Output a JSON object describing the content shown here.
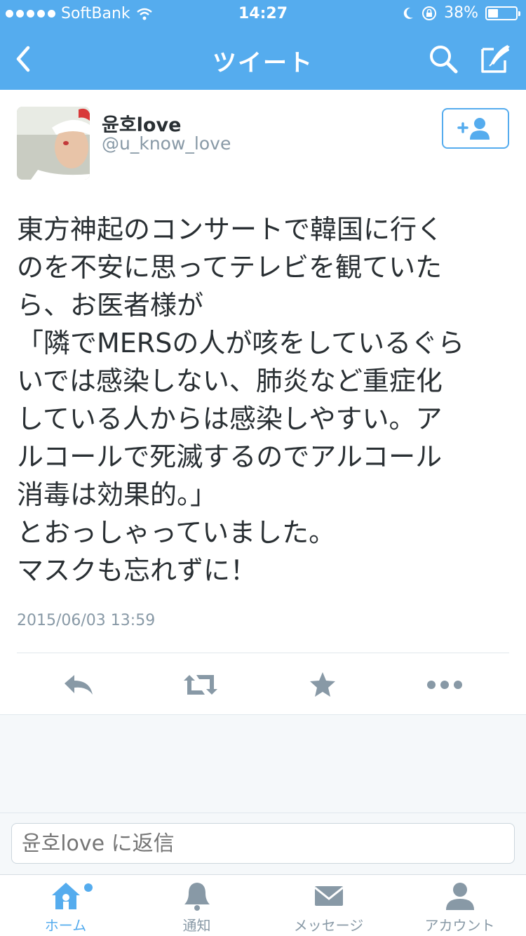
{
  "status_bar": {
    "carrier": "SoftBank",
    "time": "14:27",
    "battery_percent": "38%",
    "battery_level": 0.38
  },
  "nav": {
    "title": "ツイート"
  },
  "tweet": {
    "user_name": "윤호love",
    "user_handle": "@u_know_love",
    "text": "東方神起のコンサートで韓国に行く\nのを不安に思ってテレビを観ていた\nら、お医者様が\n「隣でMERSの人が咳をしているぐら\nいでは感染しない、肺炎など重症化\nしている人からは感染しやすい。ア\nルコールで死滅するのでアルコール\n消毒は効果的。」\nとおっしゃっていました。\nマスクも忘れずに！",
    "timestamp": "2015/06/03 13:59"
  },
  "reply": {
    "placeholder": "윤호love に返信"
  },
  "tabs": [
    {
      "label": "ホーム",
      "icon": "home-icon",
      "active": true
    },
    {
      "label": "通知",
      "icon": "bell-icon",
      "active": false
    },
    {
      "label": "メッセージ",
      "icon": "envelope-icon",
      "active": false
    },
    {
      "label": "アカウント",
      "icon": "person-icon",
      "active": false
    }
  ],
  "colors": {
    "brand": "#55acee",
    "icon_gray": "#8899a6",
    "text": "#292f33"
  }
}
